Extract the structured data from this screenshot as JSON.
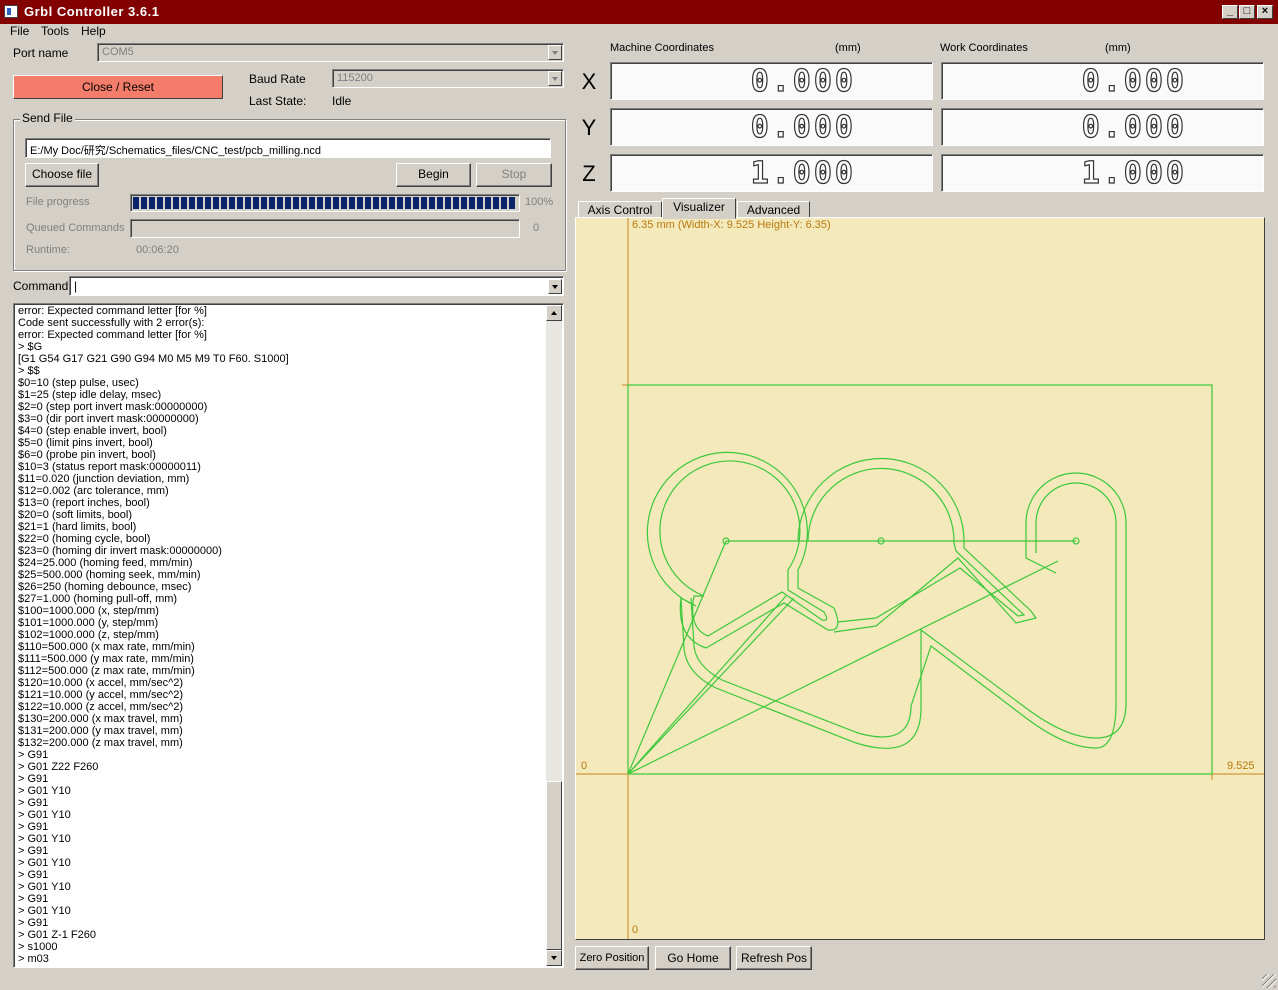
{
  "window": {
    "title": "Grbl Controller 3.6.1",
    "minimize": "_",
    "maximize": "□",
    "close": "×"
  },
  "menu": [
    "File",
    "Tools",
    "Help"
  ],
  "connection": {
    "port_label": "Port name",
    "port_value": "COM5",
    "close_reset_label": "Close / Reset",
    "close_reset_color": "#f47c6a",
    "baud_label": "Baud Rate",
    "baud_value": "115200",
    "last_state_label": "Last State:",
    "last_state_value": "Idle"
  },
  "send_file": {
    "group_label": "Send File",
    "file_path": "E:/My Doc/研究/Schematics_files/CNC_test/pcb_milling.ncd",
    "choose_label": "Choose file",
    "begin_label": "Begin",
    "stop_label": "Stop",
    "progress_label": "File progress",
    "progress_percent": 100,
    "progress_text": "100%",
    "queued_label": "Queued Commands",
    "queued_value": "0",
    "runtime_label": "Runtime:",
    "runtime_value": "00:06:20"
  },
  "command": {
    "label": "Command",
    "value": "|"
  },
  "console_lines": [
    "error: Expected command letter [for %]",
    "Code sent successfully with 2 error(s):",
    "error: Expected command letter [for %]",
    "> $G",
    "[G1 G54 G17 G21 G90 G94 M0 M5 M9 T0 F60. S1000]",
    "> $$",
    "$0=10 (step pulse, usec)",
    "$1=25 (step idle delay, msec)",
    "$2=0 (step port invert mask:00000000)",
    "$3=0 (dir port invert mask:00000000)",
    "$4=0 (step enable invert, bool)",
    "$5=0 (limit pins invert, bool)",
    "$6=0 (probe pin invert, bool)",
    "$10=3 (status report mask:00000011)",
    "$11=0.020 (junction deviation, mm)",
    "$12=0.002 (arc tolerance, mm)",
    "$13=0 (report inches, bool)",
    "$20=0 (soft limits, bool)",
    "$21=1 (hard limits, bool)",
    "$22=0 (homing cycle, bool)",
    "$23=0 (homing dir invert mask:00000000)",
    "$24=25.000 (homing feed, mm/min)",
    "$25=500.000 (homing seek, mm/min)",
    "$26=250 (homing debounce, msec)",
    "$27=1.000 (homing pull-off, mm)",
    "$100=1000.000 (x, step/mm)",
    "$101=1000.000 (y, step/mm)",
    "$102=1000.000 (z, step/mm)",
    "$110=500.000 (x max rate, mm/min)",
    "$111=500.000 (y max rate, mm/min)",
    "$112=500.000 (z max rate, mm/min)",
    "$120=10.000 (x accel, mm/sec^2)",
    "$121=10.000 (y accel, mm/sec^2)",
    "$122=10.000 (z accel, mm/sec^2)",
    "$130=200.000 (x max travel, mm)",
    "$131=200.000 (y max travel, mm)",
    "$132=200.000 (z max travel, mm)",
    "> G91",
    "> G01 Z22 F260",
    "> G91",
    "> G01 Y10",
    "> G91",
    "> G01 Y10",
    "> G91",
    "> G01 Y10",
    "> G91",
    "> G01 Y10",
    "> G91",
    "> G01 Y10",
    "> G91",
    "> G01 Y10",
    "> G91",
    "> G01 Z-1 F260",
    "> s1000",
    "> m03"
  ],
  "coordinates": {
    "machine_label": "Machine Coordinates",
    "machine_unit": "(mm)",
    "work_label": "Work Coordinates",
    "work_unit": "(mm)",
    "axes": [
      {
        "axis": "X",
        "machine": "0.000",
        "work": "0.000"
      },
      {
        "axis": "Y",
        "machine": "0.000",
        "work": "0.000"
      },
      {
        "axis": "Z",
        "machine": "1.000",
        "work": "1.000"
      }
    ]
  },
  "tabs": [
    {
      "label": "Axis Control",
      "active": false
    },
    {
      "label": "Visualizer",
      "active": true
    },
    {
      "label": "Advanced",
      "active": false
    }
  ],
  "visualizer": {
    "background": "#f3e9ba",
    "axis_color": "#c8861a",
    "path_color": "#3cc83c",
    "top_label": "6.35 mm  (Width-X: 9.525  Height-Y: 6.35)",
    "origin_label": "0",
    "bottom_label": "0",
    "right_label": "9.525"
  },
  "buttons": {
    "zero_position": "Zero Position",
    "go_home": "Go Home",
    "refresh_pos": "Refresh Pos"
  }
}
